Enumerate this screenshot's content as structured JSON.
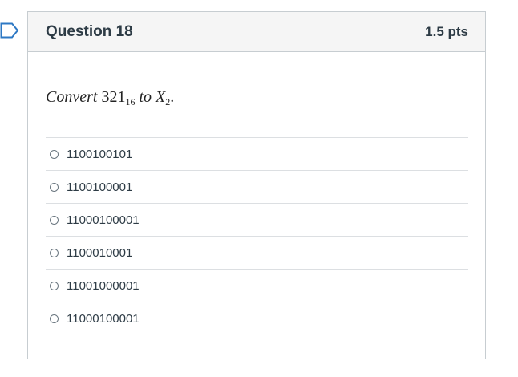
{
  "question": {
    "title": "Question 18",
    "points": "1.5 pts",
    "prompt": {
      "word_convert": "Convert",
      "number": "321",
      "base_from": "16",
      "word_to": "to",
      "target": "X",
      "base_to": "2",
      "period": "."
    }
  },
  "answers": [
    {
      "label": "1100100101"
    },
    {
      "label": "1100100001"
    },
    {
      "label": "11000100001"
    },
    {
      "label": "1100010001"
    },
    {
      "label": "11001000001"
    },
    {
      "label": "11000100001"
    }
  ],
  "colors": {
    "flag_outline": "#2d78c4",
    "header_bg": "#f5f5f5",
    "border": "#c7cdd1",
    "text": "#2d3b45"
  },
  "icons": {
    "flag": "flag-question-icon",
    "radio": "radio-unchecked-icon"
  }
}
